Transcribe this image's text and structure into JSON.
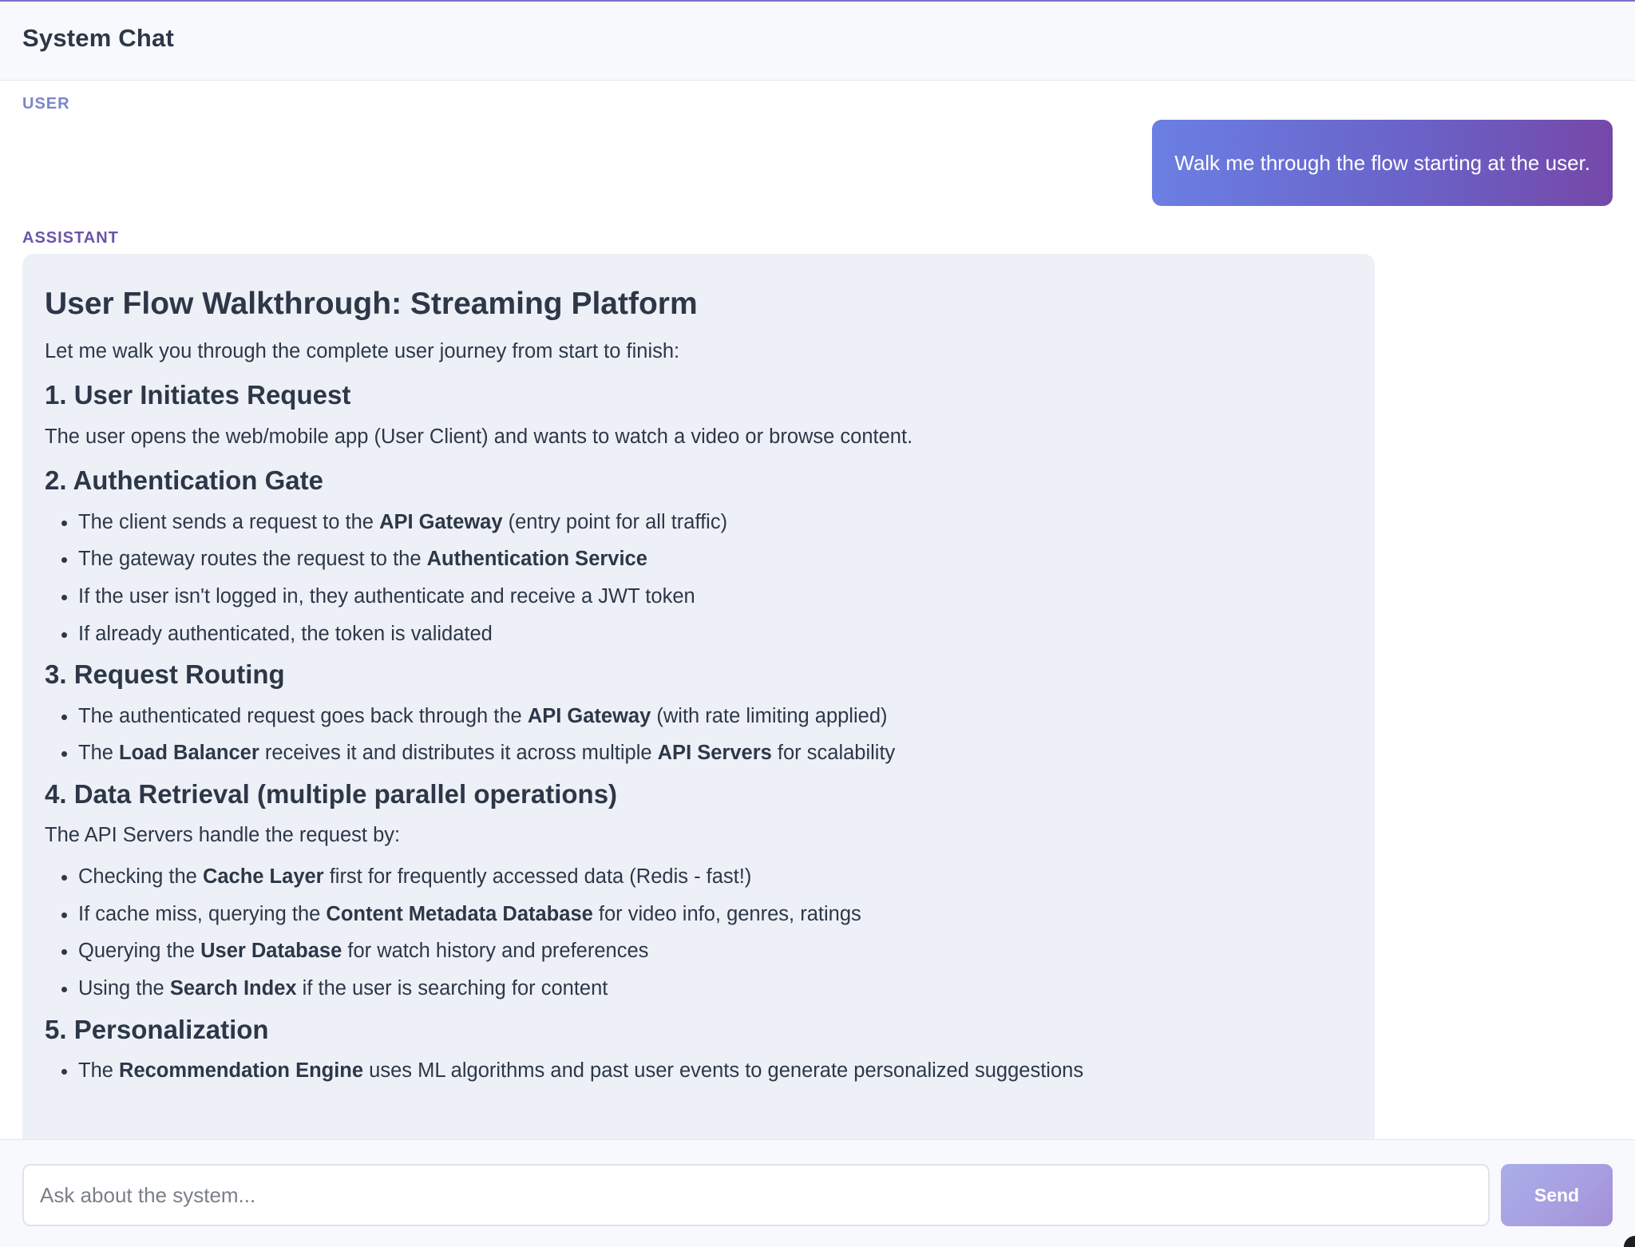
{
  "header": {
    "title": "System Chat"
  },
  "messages": {
    "user": {
      "role": "USER",
      "text": "Walk me through the flow starting at the user."
    },
    "assistant": {
      "role": "ASSISTANT",
      "title": "User Flow Walkthrough: Streaming Platform",
      "intro": "Let me walk you through the complete user journey from start to finish:",
      "sections": [
        {
          "heading": "1. User Initiates Request",
          "paragraph": "The user opens the web/mobile app (User Client) and wants to watch a video or browse content."
        },
        {
          "heading": "2. Authentication Gate",
          "items": [
            {
              "before": "The client sends a request to the ",
              "bold": "API Gateway",
              "after": " (entry point for all traffic)"
            },
            {
              "before": "The gateway routes the request to the ",
              "bold": "Authentication Service",
              "after": ""
            },
            {
              "before": "If the user isn't logged in, they authenticate and receive a JWT token",
              "bold": "",
              "after": ""
            },
            {
              "before": "If already authenticated, the token is validated",
              "bold": "",
              "after": ""
            }
          ]
        },
        {
          "heading": "3. Request Routing",
          "items": [
            {
              "before": "The authenticated request goes back through the ",
              "bold": "API Gateway",
              "after": " (with rate limiting applied)"
            },
            {
              "before": "The ",
              "bold": "Load Balancer",
              "after": " receives it and distributes it across multiple ",
              "bold2": "API Servers",
              "after2": " for scalability"
            }
          ]
        },
        {
          "heading": "4. Data Retrieval (multiple parallel operations)",
          "paragraph": "The API Servers handle the request by:",
          "items": [
            {
              "before": "Checking the ",
              "bold": "Cache Layer",
              "after": " first for frequently accessed data (Redis - fast!)"
            },
            {
              "before": "If cache miss, querying the ",
              "bold": "Content Metadata Database",
              "after": " for video info, genres, ratings"
            },
            {
              "before": "Querying the ",
              "bold": "User Database",
              "after": " for watch history and preferences"
            },
            {
              "before": "Using the ",
              "bold": "Search Index",
              "after": " if the user is searching for content"
            }
          ]
        },
        {
          "heading": "5. Personalization",
          "items": [
            {
              "before": "The ",
              "bold": "Recommendation Engine",
              "after": " uses ML algorithms and past user events to generate personalized suggestions"
            }
          ]
        }
      ]
    }
  },
  "composer": {
    "placeholder": "Ask about the system...",
    "value": "",
    "send_label": "Send"
  },
  "colors": {
    "accent_start": "#6b7fe3",
    "accent_end": "#7548a8",
    "assistant_bg": "#edf1f7",
    "user_label": "#7b86c9",
    "assistant_label": "#6a55a8"
  }
}
